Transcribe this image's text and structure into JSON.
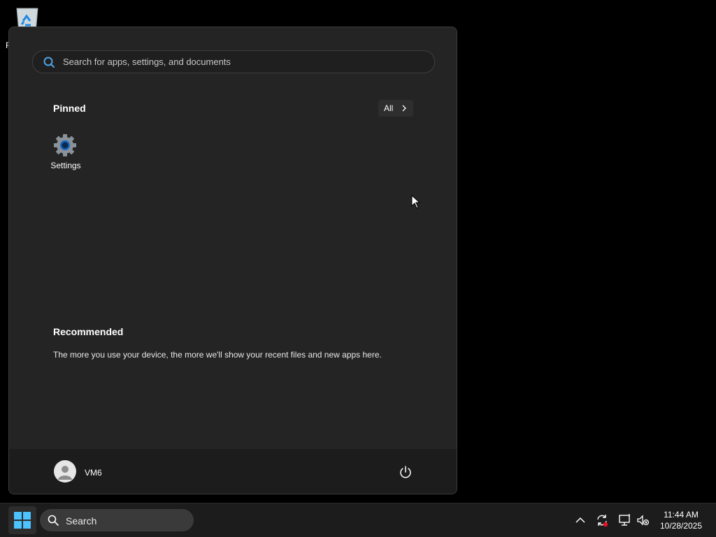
{
  "desktop": {
    "recycle_bin_label_partial": "F"
  },
  "start_menu": {
    "search": {
      "placeholder": "Search for apps, settings, and documents"
    },
    "pinned": {
      "title": "Pinned",
      "all_button": "All",
      "apps": [
        {
          "name": "Settings",
          "icon": "settings-gear-icon"
        }
      ]
    },
    "recommended": {
      "title": "Recommended",
      "empty_message": "The more you use your device, the more we'll show your recent files and new apps here."
    },
    "user": {
      "name": "VM6"
    }
  },
  "taskbar": {
    "search_label": "Search",
    "tray_icons": [
      "chevron-up-icon",
      "sync-icon",
      "network-icon",
      "volume-muted-icon"
    ],
    "clock": {
      "time": "11:44 AM",
      "date": "10/28/2025"
    }
  },
  "colors": {
    "accent": "#0078d4",
    "menu_bg": "#242424",
    "taskbar_bg": "#1c1c1c"
  }
}
